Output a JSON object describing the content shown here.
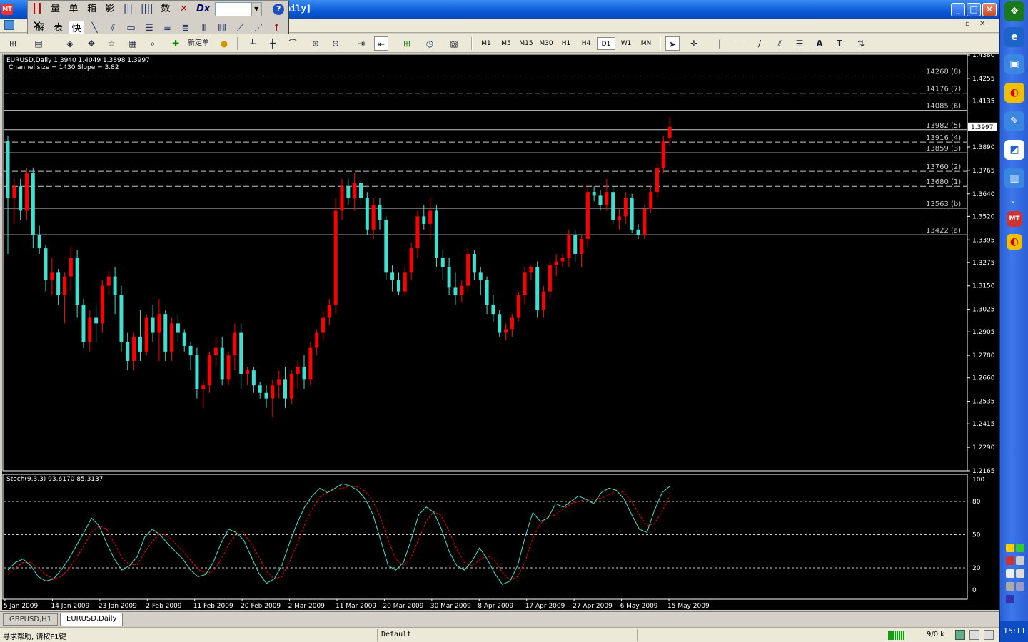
{
  "window": {
    "title_fragment": "aily]",
    "min_label": "_",
    "max_label": "□",
    "close_label": "✕"
  },
  "float_toolbar": {
    "row1": [
      "量",
      "单",
      "箱",
      "影",
      "数"
    ],
    "row2": [
      "解",
      "表",
      "快"
    ],
    "help_label": "?",
    "close_label": "✕"
  },
  "toolbar": {
    "new_order_label": "新定单",
    "timeframes": [
      "M1",
      "M5",
      "M15",
      "M30",
      "H1",
      "H4",
      "D1",
      "W1",
      "MN"
    ],
    "active_timeframe": "D1",
    "tool_labels": [
      "|",
      "—",
      "/",
      "A",
      "T"
    ]
  },
  "chart": {
    "ohlc_text": "EURUSD,Daily  1.3940 1.4049 1.3898 1.3997",
    "channel_info": "Channel size = 1430 Slope = 3.82",
    "current_price_label": "1.3997",
    "current_price": 1.3997,
    "stoch_label": "Stoch(9,3,3) 93.6170 85.3137",
    "colors": {
      "up": "#ff0000",
      "down": "#40e0d0",
      "signal": "#ff0000",
      "main": "#40e0d0",
      "bg": "#000000"
    }
  },
  "chart_data": {
    "type": "candlestick",
    "title": "EURUSD,Daily",
    "y_ticks": [
      1.438,
      1.4255,
      1.4135,
      1.389,
      1.3765,
      1.364,
      1.352,
      1.3395,
      1.3275,
      1.315,
      1.3025,
      1.2905,
      1.278,
      1.266,
      1.2535,
      1.2415,
      1.229,
      1.2165
    ],
    "ylim": [
      1.2165,
      1.438
    ],
    "x_labels": [
      "5 Jan 2009",
      "14 Jan 2009",
      "23 Jan 2009",
      "2 Feb 2009",
      "11 Feb 2009",
      "20 Feb 2009",
      "2 Mar 2009",
      "11 Mar 2009",
      "20 Mar 2009",
      "30 Mar 2009",
      "8 Apr 2009",
      "17 Apr 2009",
      "27 Apr 2009",
      "6 May 2009",
      "15 May 2009"
    ],
    "levels": [
      {
        "label": "14268 (8)",
        "value": 1.4268,
        "style": "dashed"
      },
      {
        "label": "14176 (7)",
        "value": 1.4176,
        "style": "dashed"
      },
      {
        "label": "14085 (6)",
        "value": 1.4085,
        "style": "solid"
      },
      {
        "label": "13982 (5)",
        "value": 1.3982,
        "style": "solid"
      },
      {
        "label": "13916 (4)",
        "value": 1.3916,
        "style": "dashed"
      },
      {
        "label": "13859 (3)",
        "value": 1.3859,
        "style": "solid"
      },
      {
        "label": "13760 (2)",
        "value": 1.376,
        "style": "dashed"
      },
      {
        "label": "13680 (1)",
        "value": 1.368,
        "style": "dashed"
      },
      {
        "label": "13563 (b)",
        "value": 1.3563,
        "style": "solid"
      },
      {
        "label": "13422 (a)",
        "value": 1.3422,
        "style": "solid"
      }
    ],
    "candles": [
      [
        1.392,
        1.395,
        1.332,
        1.362
      ],
      [
        1.362,
        1.372,
        1.348,
        1.368
      ],
      [
        1.368,
        1.372,
        1.35,
        1.355
      ],
      [
        1.355,
        1.378,
        1.35,
        1.375
      ],
      [
        1.375,
        1.378,
        1.335,
        1.342
      ],
      [
        1.342,
        1.347,
        1.332,
        1.335
      ],
      [
        1.335,
        1.337,
        1.312,
        1.318
      ],
      [
        1.318,
        1.33,
        1.31,
        1.322
      ],
      [
        1.322,
        1.324,
        1.305,
        1.31
      ],
      [
        1.31,
        1.322,
        1.295,
        1.32
      ],
      [
        1.32,
        1.336,
        1.312,
        1.33
      ],
      [
        1.33,
        1.334,
        1.298,
        1.305
      ],
      [
        1.305,
        1.308,
        1.282,
        1.285
      ],
      [
        1.285,
        1.302,
        1.28,
        1.298
      ],
      [
        1.298,
        1.305,
        1.285,
        1.295
      ],
      [
        1.295,
        1.318,
        1.29,
        1.315
      ],
      [
        1.315,
        1.323,
        1.31,
        1.32
      ],
      [
        1.32,
        1.325,
        1.3,
        1.31
      ],
      [
        1.31,
        1.315,
        1.28,
        1.285
      ],
      [
        1.285,
        1.29,
        1.27,
        1.275
      ],
      [
        1.275,
        1.29,
        1.27,
        1.288
      ],
      [
        1.288,
        1.302,
        1.275,
        1.28
      ],
      [
        1.28,
        1.3,
        1.278,
        1.298
      ],
      [
        1.298,
        1.305,
        1.285,
        1.29
      ],
      [
        1.29,
        1.308,
        1.275,
        1.3
      ],
      [
        1.3,
        1.302,
        1.275,
        1.28
      ],
      [
        1.28,
        1.298,
        1.275,
        1.295
      ],
      [
        1.295,
        1.3,
        1.285,
        1.29
      ],
      [
        1.29,
        1.292,
        1.28,
        1.283
      ],
      [
        1.283,
        1.285,
        1.27,
        1.278
      ],
      [
        1.278,
        1.282,
        1.255,
        1.26
      ],
      [
        1.26,
        1.265,
        1.25,
        1.262
      ],
      [
        1.262,
        1.28,
        1.258,
        1.278
      ],
      [
        1.278,
        1.288,
        1.272,
        1.282
      ],
      [
        1.282,
        1.288,
        1.262,
        1.265
      ],
      [
        1.265,
        1.28,
        1.262,
        1.278
      ],
      [
        1.278,
        1.295,
        1.27,
        1.29
      ],
      [
        1.29,
        1.295,
        1.26,
        1.268
      ],
      [
        1.268,
        1.272,
        1.262,
        1.27
      ],
      [
        1.27,
        1.272,
        1.258,
        1.262
      ],
      [
        1.262,
        1.264,
        1.255,
        1.258
      ],
      [
        1.258,
        1.262,
        1.25,
        1.255
      ],
      [
        1.255,
        1.265,
        1.245,
        1.262
      ],
      [
        1.262,
        1.27,
        1.255,
        1.265
      ],
      [
        1.265,
        1.272,
        1.25,
        1.255
      ],
      [
        1.255,
        1.27,
        1.252,
        1.268
      ],
      [
        1.268,
        1.275,
        1.26,
        1.272
      ],
      [
        1.272,
        1.278,
        1.26,
        1.265
      ],
      [
        1.265,
        1.285,
        1.262,
        1.282
      ],
      [
        1.282,
        1.292,
        1.278,
        1.29
      ],
      [
        1.29,
        1.302,
        1.286,
        1.298
      ],
      [
        1.298,
        1.308,
        1.294,
        1.305
      ],
      [
        1.305,
        1.362,
        1.3,
        1.355
      ],
      [
        1.355,
        1.372,
        1.35,
        1.368
      ],
      [
        1.368,
        1.372,
        1.358,
        1.362
      ],
      [
        1.362,
        1.375,
        1.355,
        1.37
      ],
      [
        1.37,
        1.372,
        1.358,
        1.362
      ],
      [
        1.362,
        1.365,
        1.342,
        1.345
      ],
      [
        1.345,
        1.362,
        1.34,
        1.358
      ],
      [
        1.358,
        1.362,
        1.345,
        1.35
      ],
      [
        1.35,
        1.352,
        1.318,
        1.322
      ],
      [
        1.322,
        1.326,
        1.312,
        1.318
      ],
      [
        1.318,
        1.322,
        1.31,
        1.312
      ],
      [
        1.312,
        1.325,
        1.31,
        1.322
      ],
      [
        1.322,
        1.338,
        1.318,
        1.335
      ],
      [
        1.335,
        1.355,
        1.33,
        1.352
      ],
      [
        1.352,
        1.358,
        1.345,
        1.348
      ],
      [
        1.348,
        1.362,
        1.34,
        1.355
      ],
      [
        1.355,
        1.358,
        1.325,
        1.33
      ],
      [
        1.33,
        1.334,
        1.318,
        1.325
      ],
      [
        1.325,
        1.33,
        1.31,
        1.314
      ],
      [
        1.314,
        1.322,
        1.305,
        1.31
      ],
      [
        1.31,
        1.318,
        1.306,
        1.315
      ],
      [
        1.315,
        1.335,
        1.312,
        1.332
      ],
      [
        1.332,
        1.334,
        1.318,
        1.322
      ],
      [
        1.322,
        1.325,
        1.31,
        1.318
      ],
      [
        1.318,
        1.32,
        1.3,
        1.305
      ],
      [
        1.305,
        1.31,
        1.296,
        1.3
      ],
      [
        1.3,
        1.302,
        1.288,
        1.29
      ],
      [
        1.29,
        1.295,
        1.286,
        1.292
      ],
      [
        1.292,
        1.3,
        1.288,
        1.298
      ],
      [
        1.298,
        1.312,
        1.296,
        1.31
      ],
      [
        1.31,
        1.325,
        1.305,
        1.322
      ],
      [
        1.322,
        1.326,
        1.318,
        1.325
      ],
      [
        1.325,
        1.328,
        1.298,
        1.302
      ],
      [
        1.302,
        1.315,
        1.298,
        1.312
      ],
      [
        1.312,
        1.328,
        1.308,
        1.326
      ],
      [
        1.326,
        1.332,
        1.32,
        1.328
      ],
      [
        1.328,
        1.332,
        1.325,
        1.33
      ],
      [
        1.33,
        1.345,
        1.325,
        1.342
      ],
      [
        1.342,
        1.345,
        1.328,
        1.332
      ],
      [
        1.332,
        1.342,
        1.325,
        1.34
      ],
      [
        1.34,
        1.368,
        1.336,
        1.365
      ],
      [
        1.365,
        1.368,
        1.36,
        1.363
      ],
      [
        1.363,
        1.366,
        1.355,
        1.358
      ],
      [
        1.358,
        1.372,
        1.355,
        1.365
      ],
      [
        1.365,
        1.368,
        1.348,
        1.35
      ],
      [
        1.35,
        1.356,
        1.345,
        1.352
      ],
      [
        1.352,
        1.365,
        1.348,
        1.362
      ],
      [
        1.362,
        1.364,
        1.343,
        1.345
      ],
      [
        1.345,
        1.348,
        1.34,
        1.342
      ],
      [
        1.342,
        1.358,
        1.34,
        1.356
      ],
      [
        1.356,
        1.368,
        1.354,
        1.365
      ],
      [
        1.365,
        1.38,
        1.362,
        1.378
      ],
      [
        1.378,
        1.395,
        1.375,
        1.392
      ],
      [
        1.394,
        1.4049,
        1.3898,
        1.3997
      ]
    ],
    "stochastic": {
      "label": "Stoch(9,3,3) 93.6170 85.3137",
      "levels": [
        80,
        50,
        20
      ],
      "y_ticks": [
        100,
        80,
        50,
        20,
        0
      ],
      "main": [
        18,
        25,
        28,
        22,
        12,
        8,
        10,
        18,
        28,
        40,
        52,
        65,
        58,
        42,
        28,
        18,
        22,
        30,
        48,
        55,
        50,
        42,
        35,
        28,
        18,
        12,
        14,
        25,
        42,
        55,
        52,
        45,
        30,
        15,
        6,
        10,
        22,
        42,
        60,
        75,
        85,
        92,
        88,
        92,
        96,
        94,
        90,
        82,
        68,
        45,
        22,
        18,
        25,
        45,
        68,
        75,
        70,
        55,
        35,
        22,
        18,
        26,
        38,
        28,
        15,
        5,
        8,
        22,
        48,
        70,
        62,
        65,
        78,
        75,
        80,
        85,
        82,
        78,
        88,
        92,
        90,
        82,
        68,
        55,
        52,
        72,
        88,
        93.617
      ],
      "signal": [
        14,
        20,
        25,
        25,
        20,
        14,
        10,
        12,
        19,
        29,
        40,
        52,
        58,
        55,
        42,
        29,
        23,
        23,
        34,
        44,
        51,
        49,
        42,
        35,
        27,
        19,
        15,
        17,
        27,
        41,
        50,
        51,
        42,
        30,
        17,
        10,
        12,
        25,
        41,
        59,
        73,
        84,
        88,
        91,
        92,
        94,
        93,
        89,
        80,
        65,
        45,
        28,
        22,
        29,
        46,
        62,
        71,
        67,
        53,
        37,
        25,
        22,
        27,
        31,
        27,
        16,
        9,
        12,
        26,
        47,
        60,
        66,
        68,
        73,
        78,
        80,
        82,
        82,
        83,
        86,
        90,
        88,
        80,
        68,
        58,
        60,
        71,
        85.3137
      ]
    }
  },
  "tabs": [
    "GBPUSD,H1",
    "EURUSD,Daily"
  ],
  "active_tab": "EURUSD,Daily",
  "statusbar": {
    "help": "寻求帮助, 请按F1键",
    "profile": "Default",
    "traffic": "9/0 k"
  },
  "system": {
    "clock": "15:11"
  }
}
